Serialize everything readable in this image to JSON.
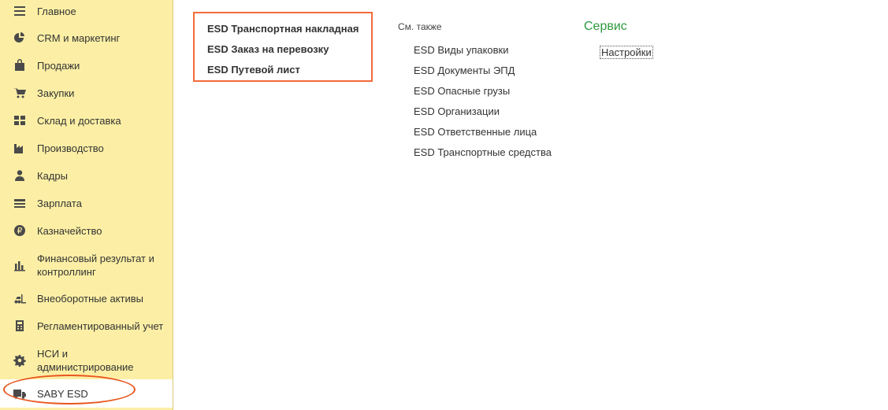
{
  "sidebar": {
    "items": [
      {
        "label": "Главное",
        "icon": "menu-lines-icon"
      },
      {
        "label": "CRM и маркетинг",
        "icon": "pie-chart-icon"
      },
      {
        "label": "Продажи",
        "icon": "shopping-bag-icon"
      },
      {
        "label": "Закупки",
        "icon": "cart-icon"
      },
      {
        "label": "Склад и доставка",
        "icon": "warehouse-grid-icon"
      },
      {
        "label": "Производство",
        "icon": "factory-icon"
      },
      {
        "label": "Кадры",
        "icon": "person-icon"
      },
      {
        "label": "Зарплата",
        "icon": "money-lines-icon"
      },
      {
        "label": "Казначейство",
        "icon": "ruble-coin-icon"
      },
      {
        "label": "Финансовый результат и контроллинг",
        "icon": "bar-chart-icon"
      },
      {
        "label": "Внеоборотные активы",
        "icon": "forklift-icon"
      },
      {
        "label": "Регламентированный учет",
        "icon": "calculator-icon"
      },
      {
        "label": "НСИ и администрирование",
        "icon": "gear-icon"
      },
      {
        "label": "SABY ESD",
        "icon": "truck-icon"
      }
    ],
    "active": "SABY ESD"
  },
  "main": {
    "links": [
      "ESD Транспортная накладная",
      "ESD Заказ на перевозку",
      "ESD Путевой лист"
    ]
  },
  "see_also": {
    "title": "См. также",
    "links": [
      "ESD Виды упаковки",
      "ESD Документы ЭПД",
      "ESD Опасные грузы",
      "ESD Организации",
      "ESD Ответственные лица",
      "ESD Транспортные средства"
    ]
  },
  "service": {
    "title": "Сервис",
    "links": [
      "Настройки"
    ]
  },
  "colors": {
    "sidebar_bg": "#fcefa5",
    "highlight": "#f26c3a",
    "service_title": "#2e9a3e"
  }
}
